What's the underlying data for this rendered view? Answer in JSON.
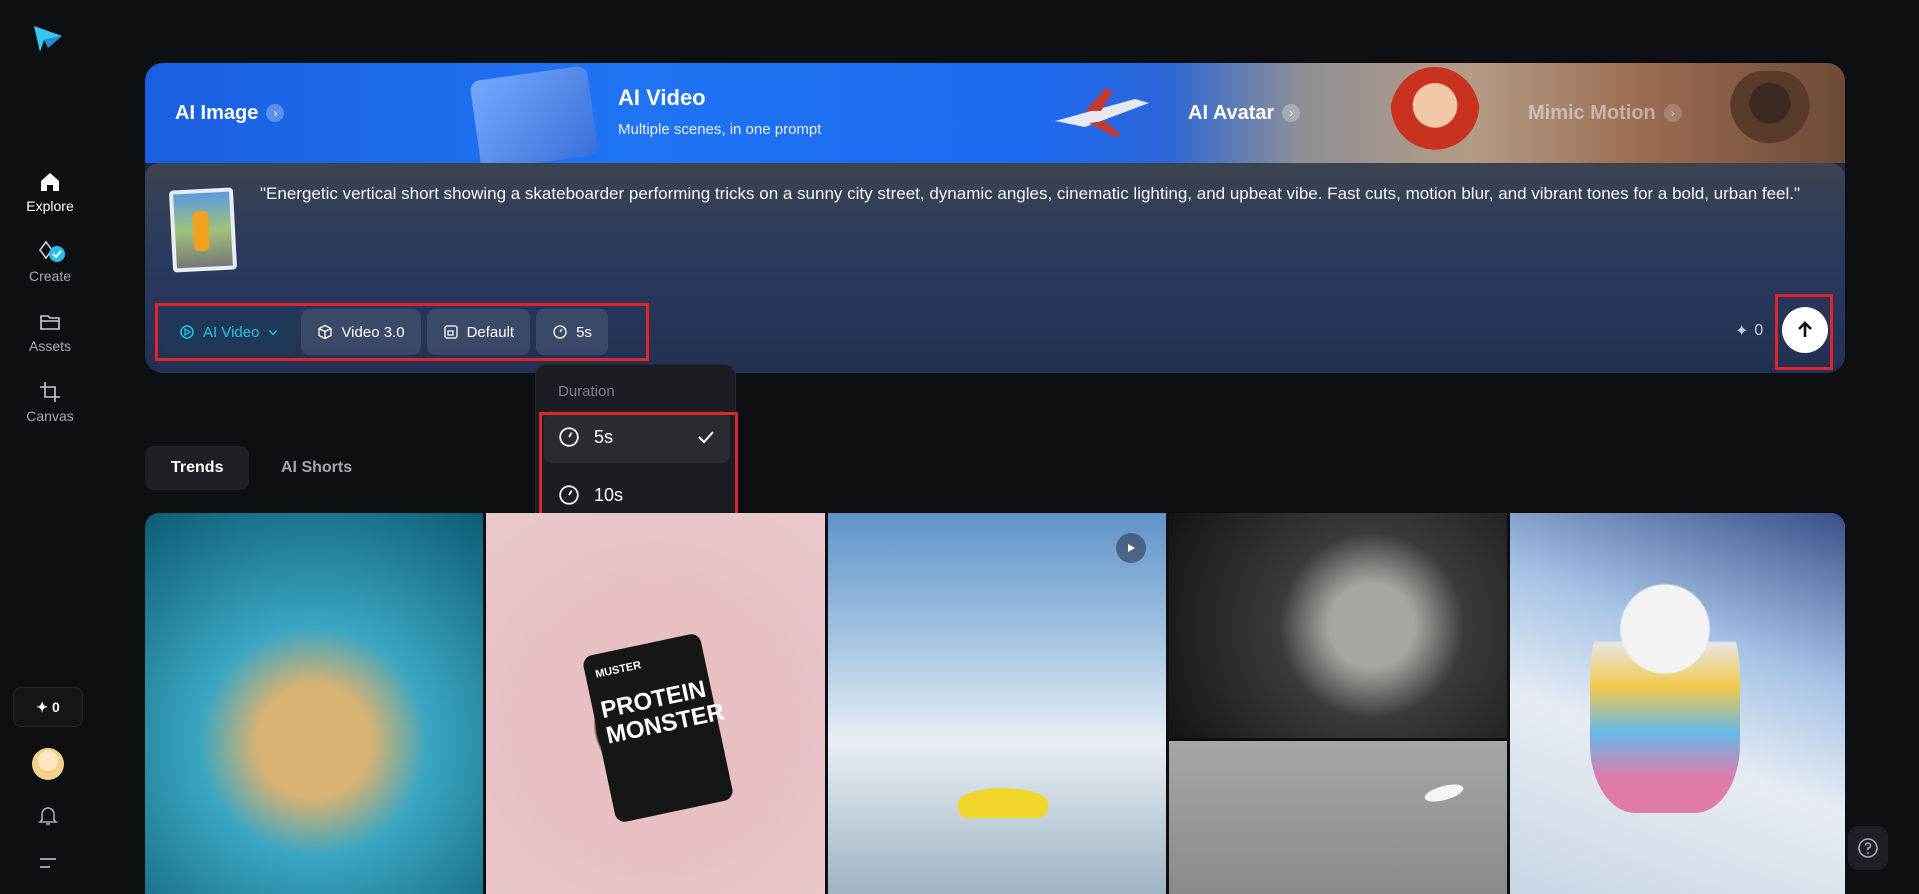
{
  "sidebar": {
    "items": [
      {
        "label": "Explore",
        "icon": "home-icon",
        "active": true
      },
      {
        "label": "Create",
        "icon": "sparkle-pen-icon",
        "active": false
      },
      {
        "label": "Assets",
        "icon": "folder-icon",
        "active": false
      },
      {
        "label": "Canvas",
        "icon": "crop-icon",
        "active": false
      }
    ],
    "credits": "0"
  },
  "hero": {
    "tabs": [
      {
        "label": "AI Image"
      },
      {
        "label": "AI Avatar"
      },
      {
        "label": "Mimic Motion"
      }
    ],
    "active_tab": {
      "title": "AI Video",
      "subtitle": "Multiple scenes, in one prompt"
    },
    "prompt": "\"Energetic vertical short showing a skateboarder performing tricks on a sunny city street, dynamic angles, cinematic lighting, and upbeat vibe. Fast cuts, motion blur, and vibrant tones for a bold, urban feel.\"",
    "controls": {
      "mode": "AI Video",
      "model": "Video 3.0",
      "ratio": "Default",
      "duration": "5s"
    },
    "cost": "0"
  },
  "duration_menu": {
    "title": "Duration",
    "options": [
      {
        "label": "5s",
        "selected": true
      },
      {
        "label": "10s",
        "selected": false
      }
    ]
  },
  "feed": {
    "tabs": [
      {
        "label": "Trends",
        "active": true
      },
      {
        "label": "AI Shorts",
        "active": false
      }
    ],
    "cards": [
      {
        "label": ""
      },
      {
        "brand": "MUSTER",
        "title": "PROTEIN MONSTER"
      }
    ]
  },
  "colors": {
    "accent": "#26c1ea",
    "highlight_box": "#e0242e",
    "background": "#0e0f12"
  }
}
